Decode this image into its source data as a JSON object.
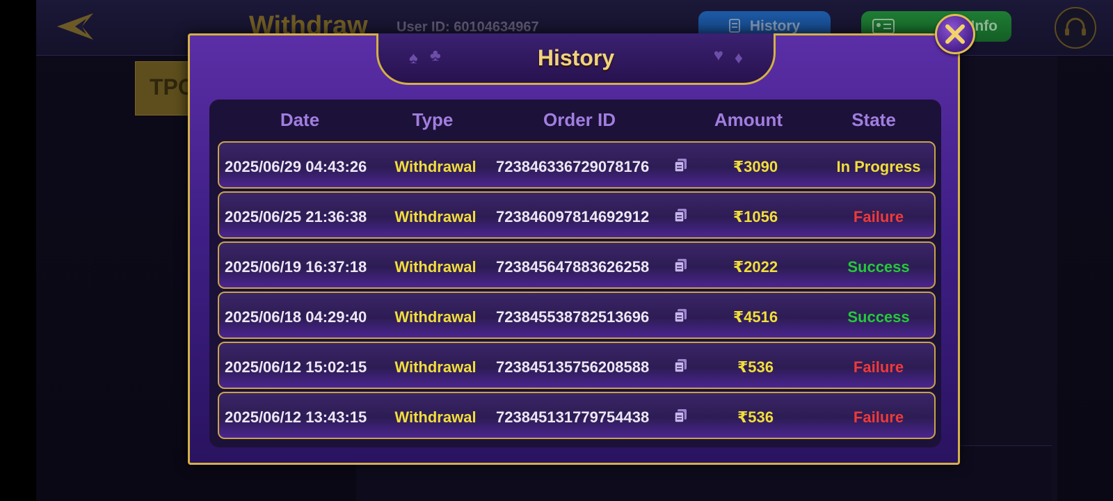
{
  "background": {
    "title": "Withdraw",
    "user_id": "User ID: 60104634967",
    "history_button": "History",
    "info_button": "Info",
    "tpc_label": "TPC"
  },
  "modal": {
    "title": "History",
    "columns": {
      "date": "Date",
      "type": "Type",
      "order_id": "Order ID",
      "amount": "Amount",
      "state": "State"
    },
    "rows": [
      {
        "date": "2025/06/29 04:43:26",
        "type": "Withdrawal",
        "order_id": "723846336729078176",
        "amount": "₹3090",
        "state": "In Progress"
      },
      {
        "date": "2025/06/25 21:36:38",
        "type": "Withdrawal",
        "order_id": "723846097814692912",
        "amount": "₹1056",
        "state": "Failure"
      },
      {
        "date": "2025/06/19 16:37:18",
        "type": "Withdrawal",
        "order_id": "723845647883626258",
        "amount": "₹2022",
        "state": "Success"
      },
      {
        "date": "2025/06/18 04:29:40",
        "type": "Withdrawal",
        "order_id": "723845538782513696",
        "amount": "₹4516",
        "state": "Success"
      },
      {
        "date": "2025/06/12 15:02:15",
        "type": "Withdrawal",
        "order_id": "723845135756208588",
        "amount": "₹536",
        "state": "Failure"
      },
      {
        "date": "2025/06/12 13:43:15",
        "type": "Withdrawal",
        "order_id": "723845131779754438",
        "amount": "₹536",
        "state": "Failure"
      }
    ]
  },
  "colors": {
    "accent_gold": "#d4b048",
    "state_in_progress": "#f2de3a",
    "state_failure": "#ee3a3a",
    "state_success": "#25c93c"
  },
  "icons": [
    "back-arrow-icon",
    "history-list-icon",
    "id-card-icon",
    "support-headset-icon",
    "close-icon",
    "copy-icon"
  ]
}
